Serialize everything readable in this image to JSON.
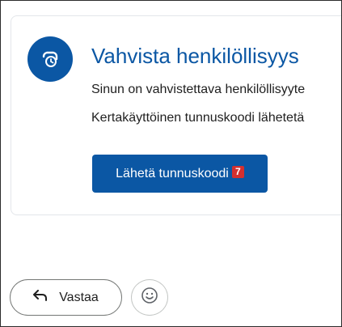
{
  "card": {
    "title": "Vahvista henkilöllisyys",
    "line1": "Sinun on vahvistettava henkilöllisyyte",
    "line2": "Kertakäyttöinen tunnuskoodi lähetetä",
    "icon": "clock-badge-icon",
    "button_label": "Lähetä tunnuskoodi",
    "button_badge": "7"
  },
  "footer": {
    "reply_label": "Vastaa",
    "reply_icon": "reply-arrow-icon",
    "emoji_icon": "smiley-icon"
  },
  "colors": {
    "accent": "#0b57a4",
    "badge": "#d32f2f"
  }
}
